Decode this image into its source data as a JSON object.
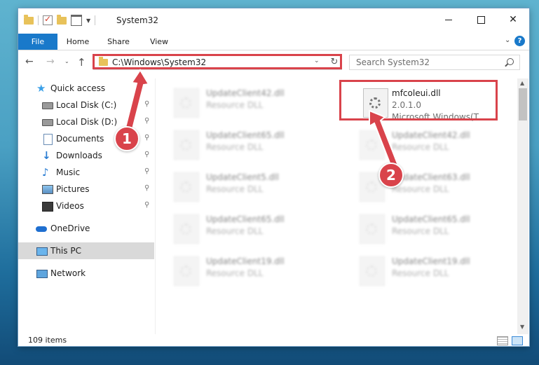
{
  "window": {
    "title": "System32",
    "minimize_glyph": "",
    "close_glyph": "✕"
  },
  "ribbon": {
    "tabs": [
      "File",
      "Home",
      "Share",
      "View"
    ],
    "help_glyph": "?",
    "expand_glyph": "⌄"
  },
  "nav": {
    "back_glyph": "←",
    "forward_glyph": "→",
    "recent_glyph": "⌄",
    "up_glyph": "↑",
    "address": "C:\\Windows\\System32",
    "address_dropdown_glyph": "⌄",
    "refresh_glyph": "↻",
    "search_placeholder": "Search System32"
  },
  "sidebar": {
    "items": [
      {
        "label": "Quick access",
        "icon": "star-icon",
        "pinned": false,
        "indent": 0
      },
      {
        "label": "Local Disk (C:)",
        "icon": "drive-icon",
        "pinned": true,
        "indent": 1
      },
      {
        "label": "Local Disk (D:)",
        "icon": "drive-icon",
        "pinned": true,
        "indent": 1
      },
      {
        "label": "Documents",
        "icon": "documents-icon",
        "pinned": true,
        "indent": 1
      },
      {
        "label": "Downloads",
        "icon": "downloads-icon",
        "pinned": true,
        "indent": 1
      },
      {
        "label": "Music",
        "icon": "music-icon",
        "pinned": true,
        "indent": 1
      },
      {
        "label": "Pictures",
        "icon": "pictures-icon",
        "pinned": true,
        "indent": 1
      },
      {
        "label": "Videos",
        "icon": "videos-icon",
        "pinned": true,
        "indent": 1
      },
      {
        "label": "OneDrive",
        "icon": "onedrive-icon",
        "pinned": false,
        "indent": 0
      },
      {
        "label": "This PC",
        "icon": "this-pc-icon",
        "pinned": false,
        "indent": 0,
        "selected": true
      },
      {
        "label": "Network",
        "icon": "network-icon",
        "pinned": false,
        "indent": 0
      }
    ],
    "pin_glyph": "📌"
  },
  "files": [
    {
      "name": "UpdateClient42.dll",
      "type": "Resource DLL",
      "column": 0,
      "row": 0,
      "blurred": true
    },
    {
      "name": "mfcoleui.dll",
      "type": "2.0.1.0",
      "company": "Microsoft Windows(T...",
      "column": 1,
      "row": 0,
      "blurred": false
    },
    {
      "name": "UpdateClient65.dll",
      "type": "Resource DLL",
      "column": 0,
      "row": 1,
      "blurred": true
    },
    {
      "name": "UpdateClient42.dll",
      "type": "Resource DLL",
      "column": 1,
      "row": 1,
      "blurred": true
    },
    {
      "name": "UpdateClient5.dll",
      "type": "Resource DLL",
      "column": 0,
      "row": 2,
      "blurred": true
    },
    {
      "name": "UpdateClient63.dll",
      "type": "Resource DLL",
      "column": 1,
      "row": 2,
      "blurred": true
    },
    {
      "name": "UpdateClient65.dll",
      "type": "Resource DLL",
      "column": 0,
      "row": 3,
      "blurred": true
    },
    {
      "name": "UpdateClient65.dll",
      "type": "Resource DLL",
      "column": 1,
      "row": 3,
      "blurred": true
    },
    {
      "name": "UpdateClient19.dll",
      "type": "Resource DLL",
      "column": 0,
      "row": 4,
      "blurred": true
    },
    {
      "name": "UpdateClient19.dll",
      "type": "Resource DLL",
      "column": 1,
      "row": 4,
      "blurred": true
    }
  ],
  "status": {
    "item_count": "109 items"
  },
  "scrollbar": {
    "up_glyph": "▲",
    "down_glyph": "▼"
  },
  "annotations": {
    "step1": "1",
    "step2": "2",
    "color": "#d9434b"
  },
  "colors": {
    "accent": "#1979ca",
    "selection": "#d9d9d9",
    "annotation": "#d9434b"
  }
}
